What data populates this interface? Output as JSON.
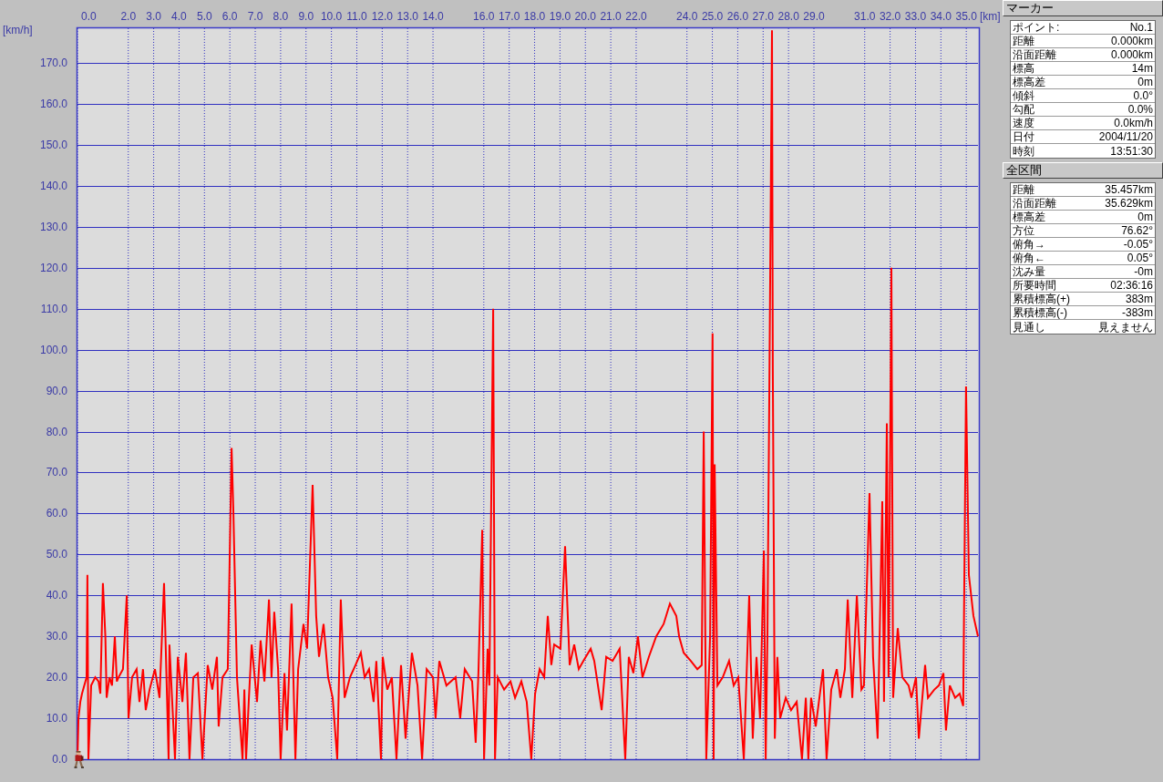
{
  "chart": {
    "chart_data": {
      "type": "line",
      "grid": true,
      "xlabel": "[km]",
      "ylabel": "[km/h]",
      "x": [
        0,
        0.04,
        0.11,
        0.18,
        0.36,
        0.39,
        0.43,
        0.54,
        0.7,
        0.83,
        0.9,
        1.0,
        1.1,
        1.15,
        1.26,
        1.36,
        1.47,
        1.55,
        1.62,
        1.79,
        1.94,
        2.01,
        2.15,
        2.33,
        2.44,
        2.58,
        2.69,
        2.84,
        3.05,
        3.23,
        3.41,
        3.59,
        3.62,
        3.84,
        3.95,
        4.13,
        4.27,
        4.41,
        4.56,
        4.74,
        4.92,
        5.13,
        5.31,
        5.49,
        5.56,
        5.71,
        5.92,
        6.07,
        6.14,
        6.28,
        6.39,
        6.5,
        6.57,
        6.64,
        6.75,
        6.86,
        7.07,
        7.21,
        7.36,
        7.54,
        7.64,
        7.75,
        7.9,
        8.0,
        8.15,
        8.25,
        8.43,
        8.58,
        8.69,
        8.9,
        9.04,
        9.26,
        9.4,
        9.51,
        9.69,
        9.87,
        10.05,
        10.23,
        10.37,
        10.52,
        10.73,
        10.95,
        11.16,
        11.31,
        11.48,
        11.66,
        11.77,
        11.95,
        12.02,
        12.2,
        12.38,
        12.56,
        12.74,
        12.92,
        13.17,
        13.39,
        13.57,
        13.75,
        14.0,
        14.1,
        14.25,
        14.53,
        14.89,
        15.07,
        15.25,
        15.54,
        15.68,
        15.79,
        15.94,
        16.01,
        16.15,
        16.22,
        16.37,
        16.44,
        16.55,
        16.8,
        17.05,
        17.23,
        17.48,
        17.69,
        17.87,
        18.02,
        18.2,
        18.38,
        18.52,
        18.66,
        18.77,
        19.02,
        19.2,
        19.38,
        19.56,
        19.74,
        19.92,
        20.21,
        20.35,
        20.64,
        20.82,
        21.07,
        21.35,
        21.57,
        21.71,
        21.89,
        22.07,
        22.25,
        22.5,
        22.79,
        23.08,
        23.33,
        23.58,
        23.69,
        23.87,
        24.15,
        24.41,
        24.58,
        24.66,
        24.76,
        24.91,
        25.01,
        25.05,
        25.09,
        25.2,
        25.41,
        25.66,
        25.84,
        26.02,
        26.24,
        26.45,
        26.59,
        26.74,
        26.88,
        27.03,
        27.1,
        27.17,
        27.28,
        27.35,
        27.38,
        27.46,
        27.56,
        27.67,
        27.89,
        28.1,
        28.32,
        28.53,
        28.68,
        28.78,
        28.89,
        29.07,
        29.36,
        29.5,
        29.68,
        29.9,
        30.04,
        30.22,
        30.33,
        30.51,
        30.69,
        30.87,
        30.97,
        31.19,
        31.33,
        31.51,
        31.62,
        31.69,
        31.76,
        31.87,
        31.94,
        32.05,
        32.12,
        32.3,
        32.48,
        32.73,
        32.84,
        33.02,
        33.13,
        33.38,
        33.49,
        33.74,
        33.92,
        34.1,
        34.2,
        34.35,
        34.56,
        34.74,
        34.88,
        34.99,
        35.1,
        35.28,
        35.46
      ],
      "series": [
        {
          "color": "#ff0000",
          "values": [
            0,
            10,
            14,
            16,
            20,
            45,
            0,
            18,
            20,
            19,
            16,
            43,
            30,
            15,
            20,
            18,
            30,
            19,
            20,
            22,
            40,
            10,
            20,
            22,
            14,
            22,
            12,
            17,
            22,
            15,
            43,
            0,
            28,
            0,
            25,
            14,
            26,
            0,
            20,
            21,
            0,
            23,
            17,
            25,
            8,
            20,
            22,
            76,
            60,
            20,
            10,
            0,
            17,
            0,
            15,
            28,
            14,
            29,
            19,
            39,
            20,
            36,
            22,
            0,
            21,
            7,
            38,
            0,
            22,
            33,
            27,
            67,
            35,
            25,
            33,
            20,
            15,
            0,
            39,
            15,
            20,
            23,
            26,
            20,
            22,
            14,
            24,
            0,
            25,
            17,
            20,
            0,
            23,
            5,
            26,
            18,
            0,
            22,
            20,
            10,
            24,
            18,
            20,
            10,
            22,
            19,
            4,
            21,
            56,
            0,
            27,
            18,
            110,
            0,
            20,
            17,
            19,
            15,
            19,
            14,
            0,
            16,
            22,
            20,
            35,
            23,
            28,
            27,
            52,
            23,
            28,
            22,
            24,
            27,
            24,
            12,
            25,
            24,
            27,
            0,
            25,
            21,
            30,
            20,
            25,
            30,
            33,
            38,
            35,
            30,
            26,
            24,
            22,
            23,
            80,
            0,
            30,
            104,
            0,
            72,
            18,
            20,
            24,
            18,
            20,
            0,
            40,
            5,
            25,
            10,
            51,
            0,
            30,
            120,
            178,
            95,
            5,
            25,
            10,
            15,
            12,
            14,
            0,
            15,
            0,
            15,
            8,
            22,
            0,
            17,
            22,
            15,
            22,
            39,
            15,
            40,
            17,
            18,
            65,
            25,
            5,
            40,
            63,
            14,
            82,
            20,
            120,
            15,
            32,
            20,
            18,
            15,
            20,
            5,
            23,
            15,
            17,
            18,
            21,
            7,
            18,
            15,
            16,
            13,
            91,
            45,
            35,
            30
          ]
        }
      ],
      "xlim": [
        0,
        35.46
      ],
      "ylim": [
        0,
        178.5
      ],
      "xticks": [
        {
          "value": 0,
          "label": "0.0"
        },
        {
          "value": 2,
          "label": "2.0"
        },
        {
          "value": 3,
          "label": "3.0"
        },
        {
          "value": 4,
          "label": "4.0"
        },
        {
          "value": 5,
          "label": "5.0"
        },
        {
          "value": 6,
          "label": "6.0"
        },
        {
          "value": 7,
          "label": "7.0"
        },
        {
          "value": 8,
          "label": "8.0"
        },
        {
          "value": 9,
          "label": "9.0"
        },
        {
          "value": 10,
          "label": "10.0"
        },
        {
          "value": 11,
          "label": "11.0"
        },
        {
          "value": 12,
          "label": "12.0"
        },
        {
          "value": 13,
          "label": "13.0"
        },
        {
          "value": 14,
          "label": "14.0"
        },
        {
          "value": 16,
          "label": "16.0"
        },
        {
          "value": 17,
          "label": "17.0"
        },
        {
          "value": 18,
          "label": "18.0"
        },
        {
          "value": 19,
          "label": "19.0"
        },
        {
          "value": 20,
          "label": "20.0"
        },
        {
          "value": 21,
          "label": "21.0"
        },
        {
          "value": 22,
          "label": "22.0"
        },
        {
          "value": 24,
          "label": "24.0"
        },
        {
          "value": 25,
          "label": "25.0"
        },
        {
          "value": 26,
          "label": "26.0"
        },
        {
          "value": 27,
          "label": "27.0"
        },
        {
          "value": 28,
          "label": "28.0"
        },
        {
          "value": 29,
          "label": "29.0"
        },
        {
          "value": 31,
          "label": "31.0"
        },
        {
          "value": 32,
          "label": "32.0"
        },
        {
          "value": 33,
          "label": "33.0"
        },
        {
          "value": 34,
          "label": "34.0"
        },
        {
          "value": 35,
          "label": "35.0"
        }
      ],
      "yticks": [
        {
          "value": 0,
          "label": "0.0"
        },
        {
          "value": 10,
          "label": "10.0"
        },
        {
          "value": 20,
          "label": "20.0"
        },
        {
          "value": 30,
          "label": "30.0"
        },
        {
          "value": 40,
          "label": "40.0"
        },
        {
          "value": 50,
          "label": "50.0"
        },
        {
          "value": 60,
          "label": "60.0"
        },
        {
          "value": 70,
          "label": "70.0"
        },
        {
          "value": 80,
          "label": "80.0"
        },
        {
          "value": 90,
          "label": "90.0"
        },
        {
          "value": 100,
          "label": "100.0"
        },
        {
          "value": 110,
          "label": "110.0"
        },
        {
          "value": 120,
          "label": "120.0"
        },
        {
          "value": 130,
          "label": "130.0"
        },
        {
          "value": 140,
          "label": "140.0"
        },
        {
          "value": 150,
          "label": "150.0"
        },
        {
          "value": 160,
          "label": "160.0"
        },
        {
          "value": 170,
          "label": "170.0"
        }
      ]
    }
  },
  "marker_panel": {
    "title": "マーカー",
    "rows": [
      {
        "label": "ポイント:",
        "value": "No.1"
      },
      {
        "label": "距離",
        "value": "0.000km"
      },
      {
        "label": "沿面距離",
        "value": "0.000km"
      },
      {
        "label": "標高",
        "value": "14m"
      },
      {
        "label": "標高差",
        "value": "0m"
      },
      {
        "label": "傾斜",
        "value": "0.0°"
      },
      {
        "label": "勾配",
        "value": "0.0%"
      },
      {
        "label": "速度",
        "value": "0.0km/h"
      },
      {
        "label": "日付",
        "value": "2004/11/20"
      },
      {
        "label": "時刻",
        "value": "13:51:30"
      }
    ]
  },
  "total_panel": {
    "title": "全区間",
    "rows": [
      {
        "label": "距離",
        "value": "35.457km"
      },
      {
        "label": "沿面距離",
        "value": "35.629km"
      },
      {
        "label": "標高差",
        "value": "0m"
      },
      {
        "label": "方位",
        "value": "76.62°"
      },
      {
        "label": "俯角→",
        "value": "-0.05°"
      },
      {
        "label": "俯角←",
        "value": "0.05°"
      },
      {
        "label": "沈み量",
        "value": "-0m"
      },
      {
        "label": "所要時間",
        "value": "02:36:16"
      },
      {
        "label": "累積標高(+)",
        "value": "383m"
      },
      {
        "label": "累積標高(-)",
        "value": "-383m"
      },
      {
        "label": "見通し",
        "value": "見えません"
      }
    ]
  }
}
